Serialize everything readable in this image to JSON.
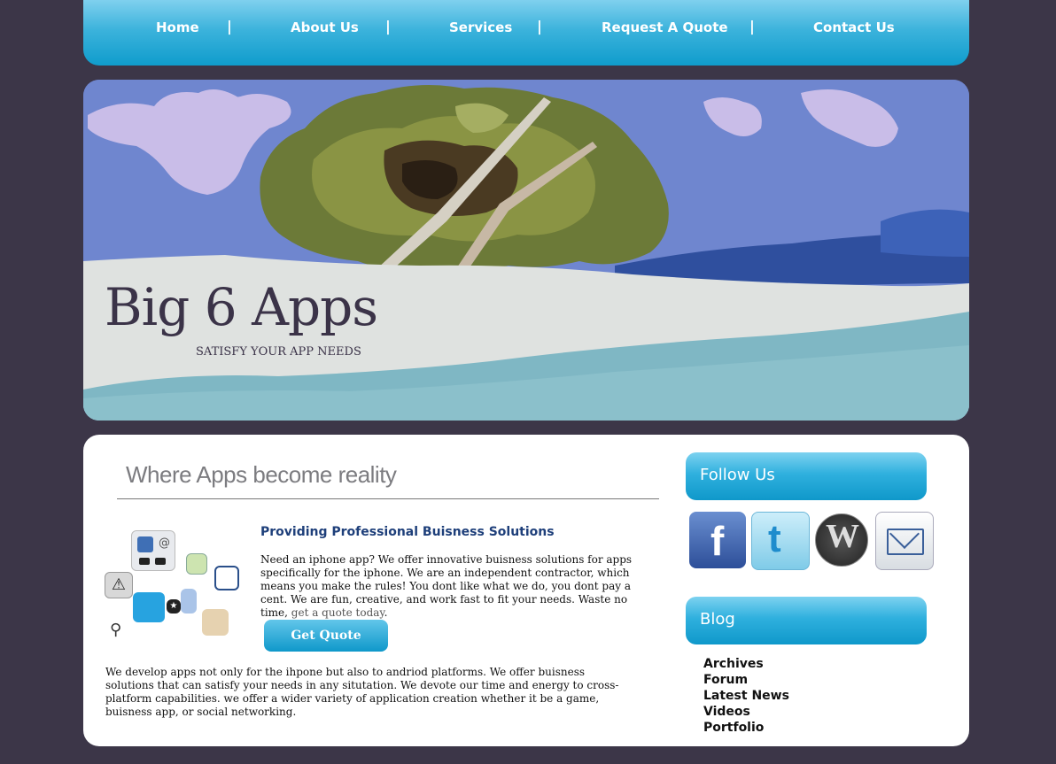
{
  "nav": {
    "items": [
      {
        "label": "Home"
      },
      {
        "label": "About Us"
      },
      {
        "label": "Services"
      },
      {
        "label": "Request A Quote"
      },
      {
        "label": "Contact Us"
      }
    ],
    "separator": "|"
  },
  "banner": {
    "title": "Big 6 Apps",
    "tagline": "SATISFY YOUR APP NEEDS"
  },
  "main": {
    "headline": "Where Apps become reality",
    "subheading": "Providing Professional Buisness Solutions",
    "intro": "Need an iphone app? We offer innovative buisness solutions for apps specifically for the iphone. We are an independent contractor, which means you make the rules! You dont like what we do, you dont pay a cent. We are fun, creative, and work fast to fit your needs. Waste no time, ",
    "intro_link": "get a quote today",
    "intro_end": ".",
    "quote_button": "Get Quote",
    "details": "We develop apps not only for the ihpone but also to andriod platforms. We offer buisness solutions that can satisfy your needs in any situtation. We devote our time and energy to cross-platform capabilities. we offer a wider variety of application creation whether it be a game, buisness app, or social networking."
  },
  "sidebar": {
    "follow_title": "Follow Us",
    "social": [
      "facebook-icon",
      "twitter-icon",
      "wordpress-icon",
      "email-icon"
    ],
    "blog_title": "Blog",
    "blog_links": [
      "Archives",
      "Forum",
      "Latest News",
      "Videos",
      "Portfolio"
    ]
  },
  "colors": {
    "background": "#3c3648",
    "accent": "#1aa6d6",
    "subheading": "#1e3f7a"
  }
}
